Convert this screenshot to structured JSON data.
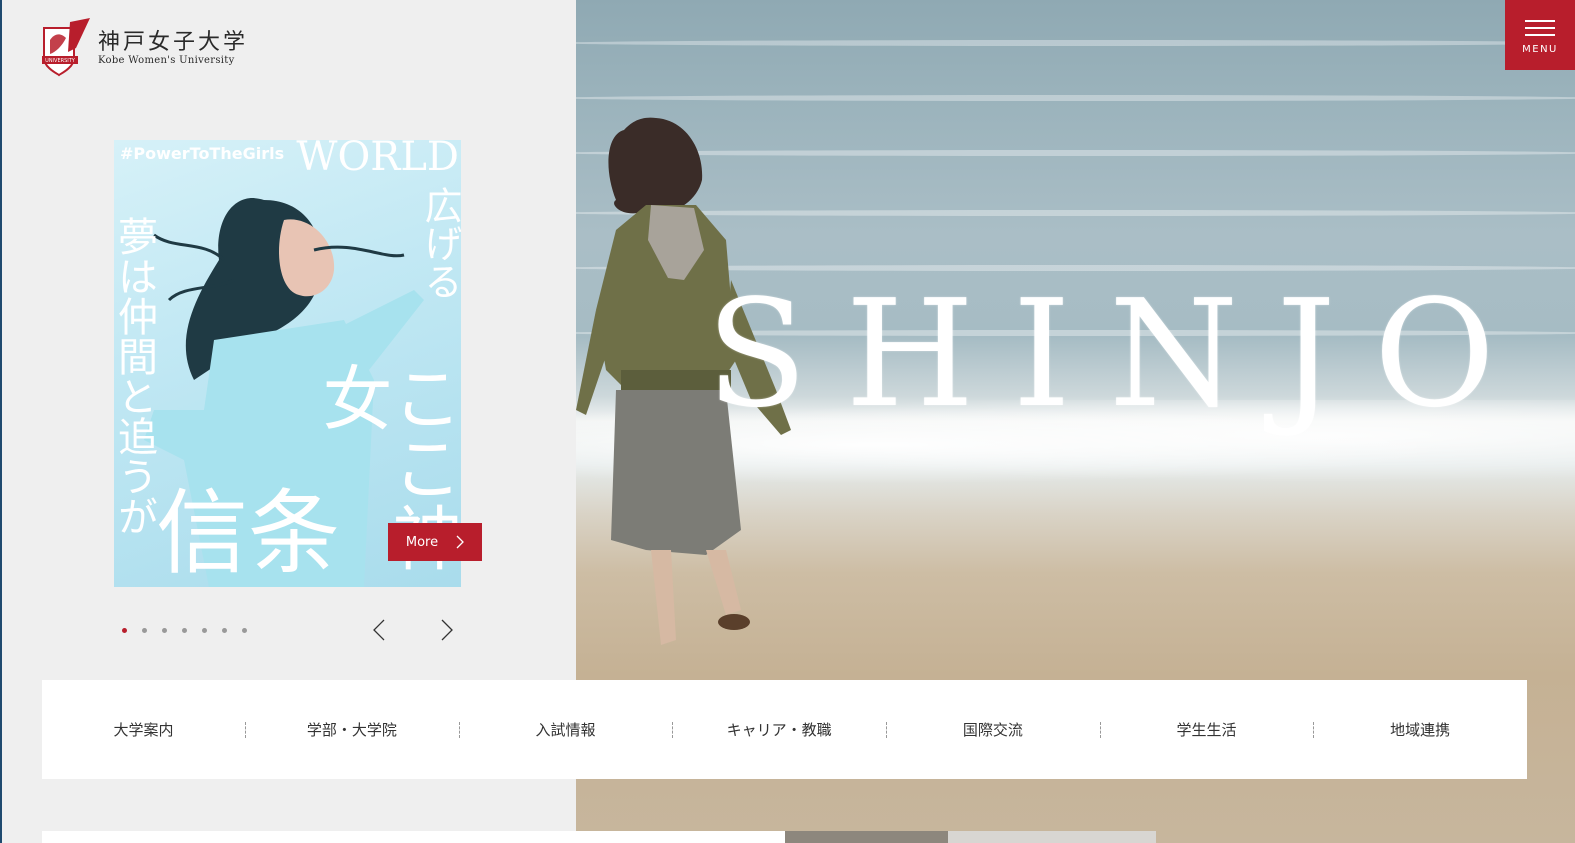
{
  "logo": {
    "name_jp": "神戸女子大学",
    "name_en": "Kobe Women's University",
    "crest_text": "UNIVERSITY"
  },
  "menu": {
    "label": "MENU"
  },
  "hero": {
    "title": "SHINJO"
  },
  "slide": {
    "hashtag": "#PowerToTheGirls",
    "world": "WORLD",
    "vertical_right": "広げる",
    "vertical_right2": "ここ神女",
    "vertical_left": "夢は仲間と追うが",
    "big": "信条",
    "more_label": "More",
    "total": 7,
    "active_index": 0
  },
  "nav": {
    "items": [
      {
        "label": "大学案内"
      },
      {
        "label": "学部・大学院"
      },
      {
        "label": "入試情報"
      },
      {
        "label": "キャリア・教職"
      },
      {
        "label": "国際交流"
      },
      {
        "label": "学生生活"
      },
      {
        "label": "地域連携"
      }
    ]
  },
  "colors": {
    "brand_red": "#b81e2c"
  },
  "icons": {
    "menu": "hamburger-icon",
    "more": "chevron-right-icon",
    "prev": "chevron-left-icon",
    "next": "chevron-right-icon"
  }
}
